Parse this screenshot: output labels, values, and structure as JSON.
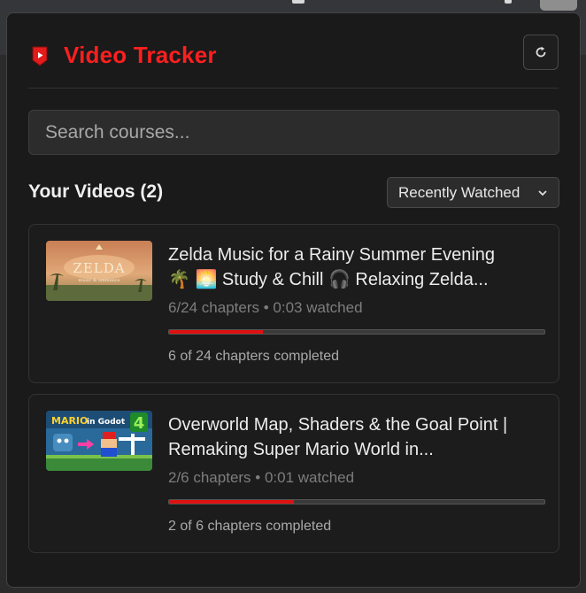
{
  "app": {
    "title": "Video Tracker",
    "accent": "#ff1f1f",
    "logo_icon": "video-tracker-logo-icon",
    "refresh_icon": "refresh-icon"
  },
  "search": {
    "placeholder": "Search courses..."
  },
  "list": {
    "heading": "Your Videos (2)",
    "sort": {
      "selected": "Recently Watched",
      "icon": "chevron-down-icon"
    }
  },
  "videos": [
    {
      "title": "Zelda Music for a Rainy Summer Evening 🌴 🌅 Study & Chill 🎧 Relaxing Zelda...",
      "meta": "6/24 chapters • 0:03 watched",
      "progress": 0.25,
      "completed": "6 of 24 chapters completed",
      "thumb_text": "ZELDA",
      "thumb_sub": "music & ambience"
    },
    {
      "title": "Overworld Map, Shaders & the Goal Point | Remaking Super Mario World in...",
      "meta": "2/6 chapters • 0:01 watched",
      "progress": 0.333,
      "completed": "2 of 6 chapters completed",
      "thumb_text": "MARIO",
      "thumb_sub": "in Godot",
      "thumb_num": "4"
    }
  ]
}
